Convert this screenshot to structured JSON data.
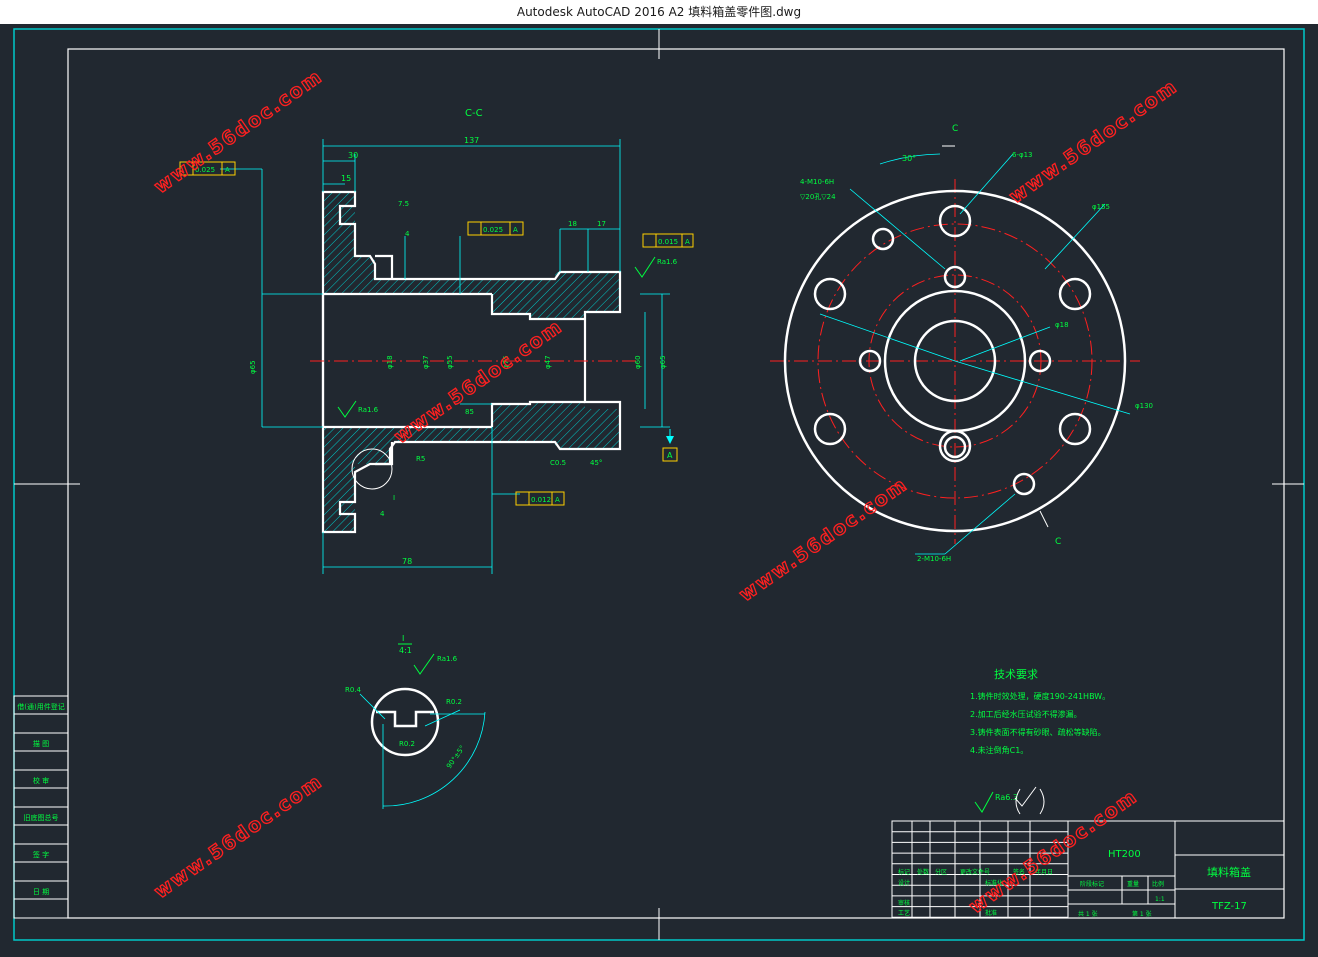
{
  "window": {
    "title": "Autodesk AutoCAD 2016     A2 填料箱盖零件图.dwg"
  },
  "colors": {
    "background": "#212830",
    "border": "#00c8c8",
    "outline": "#ffffff",
    "dimension": "#00ffff",
    "center_line": "#ff2020",
    "text": "#00ff40",
    "watermark": "#ff2020",
    "hatch": "#00ffff",
    "tolerance": "#ffd000"
  },
  "watermark": "www.56doc.com",
  "section_view": {
    "label": "C-C",
    "dims": {
      "overall_length": "137",
      "flange_thickness": "30",
      "step": "15",
      "groove_depth": "4",
      "groove_width": "7.5",
      "d1": "18",
      "d2": "17",
      "shaft_length": "78",
      "r5": "R5",
      "chamfer": "C0.5",
      "angle": "45°",
      "bore_depth": "85",
      "depth_bottom": "4"
    },
    "diameters": [
      "φ18",
      "φ37",
      "φ55",
      "φ75",
      "φ47",
      "φ60",
      "φ65"
    ],
    "tolerances": {
      "t1": "0.025",
      "t2": "0.025",
      "t3": "0.015",
      "t4": "0.012",
      "datum": "A"
    },
    "roughness": {
      "r1": "Ra1.6",
      "r2": "Ra1.6"
    }
  },
  "end_view": {
    "section_mark": "C",
    "labels": {
      "angle": "30°",
      "holes_6": "6-φ13",
      "holes_4": "4-M10-6H",
      "holes_4_depth": "▽20孔▽24",
      "d155": "φ155",
      "d18": "φ18",
      "d130": "φ130",
      "holes_2": "2-M10-6H"
    }
  },
  "detail_view": {
    "label": "I",
    "scale": "4:1",
    "roughness": "Ra1.6",
    "r_outer": "R0.4",
    "r_inner": "R0.2",
    "r_bottom": "R0.2",
    "angle": "90°±5°"
  },
  "tech_requirements": {
    "title": "技术要求",
    "items": [
      "1.铸件时效处理，硬度190-241HBW。",
      "2.加工后经水压试验不得渗漏。",
      "3.铸件表面不得有砂眼、疏松等缺陷。",
      "4.未注倒角C1。"
    ]
  },
  "roughness_general": "Ra6.3",
  "side_table": [
    "借(通)用件登记",
    "描 图",
    "校 审",
    "旧底图总号",
    "签 字",
    "日 期"
  ],
  "title_block": {
    "material": "HT200",
    "part_name": "填料箱盖",
    "drawing_no": "TFZ-17",
    "scale": "1:1",
    "row_labels": [
      "标记",
      "设计",
      "审核",
      "工艺"
    ],
    "col_labels": [
      "处数",
      "分区",
      "更改文件号",
      "签名",
      "年月日"
    ],
    "mid_labels": [
      "标准化",
      "批准"
    ],
    "stage_labels": [
      "阶段标记",
      "重量",
      "比例"
    ],
    "sheet": "共 1 张",
    "sheet_no": "第 1 张"
  }
}
